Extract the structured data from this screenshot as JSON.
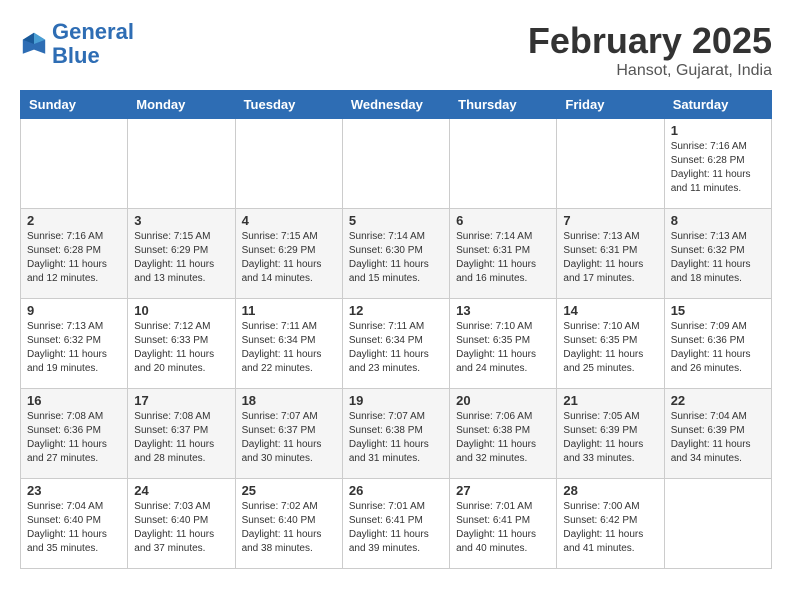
{
  "header": {
    "logo_line1": "General",
    "logo_line2": "Blue",
    "title": "February 2025",
    "subtitle": "Hansot, Gujarat, India"
  },
  "weekdays": [
    "Sunday",
    "Monday",
    "Tuesday",
    "Wednesday",
    "Thursday",
    "Friday",
    "Saturday"
  ],
  "weeks": [
    [
      {
        "day": "",
        "info": ""
      },
      {
        "day": "",
        "info": ""
      },
      {
        "day": "",
        "info": ""
      },
      {
        "day": "",
        "info": ""
      },
      {
        "day": "",
        "info": ""
      },
      {
        "day": "",
        "info": ""
      },
      {
        "day": "1",
        "info": "Sunrise: 7:16 AM\nSunset: 6:28 PM\nDaylight: 11 hours\nand 11 minutes."
      }
    ],
    [
      {
        "day": "2",
        "info": "Sunrise: 7:16 AM\nSunset: 6:28 PM\nDaylight: 11 hours\nand 12 minutes."
      },
      {
        "day": "3",
        "info": "Sunrise: 7:15 AM\nSunset: 6:29 PM\nDaylight: 11 hours\nand 13 minutes."
      },
      {
        "day": "4",
        "info": "Sunrise: 7:15 AM\nSunset: 6:29 PM\nDaylight: 11 hours\nand 14 minutes."
      },
      {
        "day": "5",
        "info": "Sunrise: 7:14 AM\nSunset: 6:30 PM\nDaylight: 11 hours\nand 15 minutes."
      },
      {
        "day": "6",
        "info": "Sunrise: 7:14 AM\nSunset: 6:31 PM\nDaylight: 11 hours\nand 16 minutes."
      },
      {
        "day": "7",
        "info": "Sunrise: 7:13 AM\nSunset: 6:31 PM\nDaylight: 11 hours\nand 17 minutes."
      },
      {
        "day": "8",
        "info": "Sunrise: 7:13 AM\nSunset: 6:32 PM\nDaylight: 11 hours\nand 18 minutes."
      }
    ],
    [
      {
        "day": "9",
        "info": "Sunrise: 7:13 AM\nSunset: 6:32 PM\nDaylight: 11 hours\nand 19 minutes."
      },
      {
        "day": "10",
        "info": "Sunrise: 7:12 AM\nSunset: 6:33 PM\nDaylight: 11 hours\nand 20 minutes."
      },
      {
        "day": "11",
        "info": "Sunrise: 7:11 AM\nSunset: 6:34 PM\nDaylight: 11 hours\nand 22 minutes."
      },
      {
        "day": "12",
        "info": "Sunrise: 7:11 AM\nSunset: 6:34 PM\nDaylight: 11 hours\nand 23 minutes."
      },
      {
        "day": "13",
        "info": "Sunrise: 7:10 AM\nSunset: 6:35 PM\nDaylight: 11 hours\nand 24 minutes."
      },
      {
        "day": "14",
        "info": "Sunrise: 7:10 AM\nSunset: 6:35 PM\nDaylight: 11 hours\nand 25 minutes."
      },
      {
        "day": "15",
        "info": "Sunrise: 7:09 AM\nSunset: 6:36 PM\nDaylight: 11 hours\nand 26 minutes."
      }
    ],
    [
      {
        "day": "16",
        "info": "Sunrise: 7:08 AM\nSunset: 6:36 PM\nDaylight: 11 hours\nand 27 minutes."
      },
      {
        "day": "17",
        "info": "Sunrise: 7:08 AM\nSunset: 6:37 PM\nDaylight: 11 hours\nand 28 minutes."
      },
      {
        "day": "18",
        "info": "Sunrise: 7:07 AM\nSunset: 6:37 PM\nDaylight: 11 hours\nand 30 minutes."
      },
      {
        "day": "19",
        "info": "Sunrise: 7:07 AM\nSunset: 6:38 PM\nDaylight: 11 hours\nand 31 minutes."
      },
      {
        "day": "20",
        "info": "Sunrise: 7:06 AM\nSunset: 6:38 PM\nDaylight: 11 hours\nand 32 minutes."
      },
      {
        "day": "21",
        "info": "Sunrise: 7:05 AM\nSunset: 6:39 PM\nDaylight: 11 hours\nand 33 minutes."
      },
      {
        "day": "22",
        "info": "Sunrise: 7:04 AM\nSunset: 6:39 PM\nDaylight: 11 hours\nand 34 minutes."
      }
    ],
    [
      {
        "day": "23",
        "info": "Sunrise: 7:04 AM\nSunset: 6:40 PM\nDaylight: 11 hours\nand 35 minutes."
      },
      {
        "day": "24",
        "info": "Sunrise: 7:03 AM\nSunset: 6:40 PM\nDaylight: 11 hours\nand 37 minutes."
      },
      {
        "day": "25",
        "info": "Sunrise: 7:02 AM\nSunset: 6:40 PM\nDaylight: 11 hours\nand 38 minutes."
      },
      {
        "day": "26",
        "info": "Sunrise: 7:01 AM\nSunset: 6:41 PM\nDaylight: 11 hours\nand 39 minutes."
      },
      {
        "day": "27",
        "info": "Sunrise: 7:01 AM\nSunset: 6:41 PM\nDaylight: 11 hours\nand 40 minutes."
      },
      {
        "day": "28",
        "info": "Sunrise: 7:00 AM\nSunset: 6:42 PM\nDaylight: 11 hours\nand 41 minutes."
      },
      {
        "day": "",
        "info": ""
      }
    ]
  ]
}
